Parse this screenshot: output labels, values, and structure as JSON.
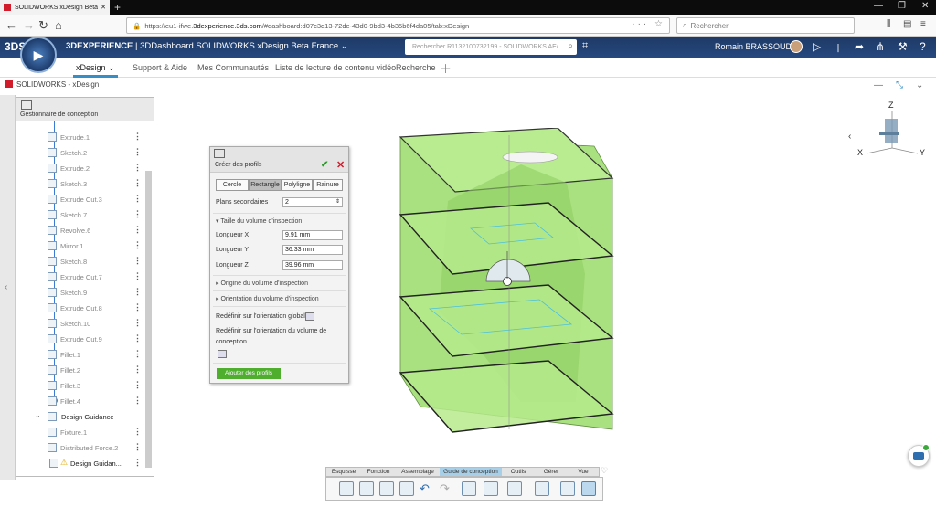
{
  "browser": {
    "tab_title": "SOLIDWORKS xDesign Beta Fra",
    "url_prefix": "https://eu1-ifwe.",
    "url_domain": "3dexperience.3ds.com",
    "url_rest": "/#dashboard:d07c3d13-72de-43d0-9bd3-4b35b6f4da05/tab:xDesign",
    "search_placeholder": "Rechercher"
  },
  "header": {
    "brand_bold": "3DEXPERIENCE",
    "title_rest": " | 3DDashboard SOLIDWORKS xDesign Beta France",
    "search_placeholder": "Rechercher R1132100732199 - SOLIDWORKS AE/",
    "user_name": "Romain BRASSOUD"
  },
  "app_tabs": [
    "xDesign",
    "Support & Aide",
    "Mes Communautés",
    "Liste de lecture de contenu vidéo",
    "Recherche"
  ],
  "workspace_title": "SOLIDWORKS - xDesign",
  "tree": {
    "header": "Gestionnaire de conception",
    "items": [
      "Extrude.1",
      "Sketch.2",
      "Extrude.2",
      "Sketch.3",
      "Extrude Cut.3",
      "Sketch.7",
      "Revolve.6",
      "Mirror.1",
      "Sketch.8",
      "Extrude Cut.7",
      "Sketch.9",
      "Extrude Cut.8",
      "Sketch.10",
      "Extrude Cut.9",
      "Fillet.1",
      "Fillet.2",
      "Fillet.3",
      "Fillet.4"
    ],
    "group_title": "Design Guidance",
    "group_items": [
      "Fixture.1",
      "Distributed Force.2",
      "Design Guidan..."
    ]
  },
  "dialog": {
    "title": "Créer des profils",
    "modes": [
      "Cercle",
      "Rectangle",
      "Polyligne",
      "Rainure"
    ],
    "selected_mode": "Rectangle",
    "secondary_planes_label": "Plans secondaires",
    "secondary_planes_value": "2",
    "section_volume": "Taille du volume d'inspection",
    "length_x_label": "Longueur X",
    "length_x_value": "9.91 mm",
    "length_y_label": "Longueur Y",
    "length_y_value": "36.33 mm",
    "length_z_label": "Longueur Z",
    "length_z_value": "39.96 mm",
    "section_origin": "Origine du volume d'inspection",
    "section_orientation": "Orientation du volume d'inspection",
    "redefine_global": "Redéfinir sur l'orientation globale",
    "redefine_design": "Redéfinir sur l'orientation du volume de conception",
    "add_button": "Ajouter des profils"
  },
  "viewcube": {
    "z": "Z",
    "x": "X",
    "y": "Y"
  },
  "command_tabs": [
    "Esquisse",
    "Fonction",
    "Assemblage",
    "Guide de conception",
    "Outils",
    "Gérer",
    "Vue"
  ],
  "selected_command_tab": "Guide de conception",
  "colors": {
    "header": "#25487f",
    "accent": "#368ec4",
    "model_green": "#a6e07a",
    "ok": "#2a9a2a",
    "cancel": "#d21c2c",
    "add_button": "#4fae2e"
  }
}
